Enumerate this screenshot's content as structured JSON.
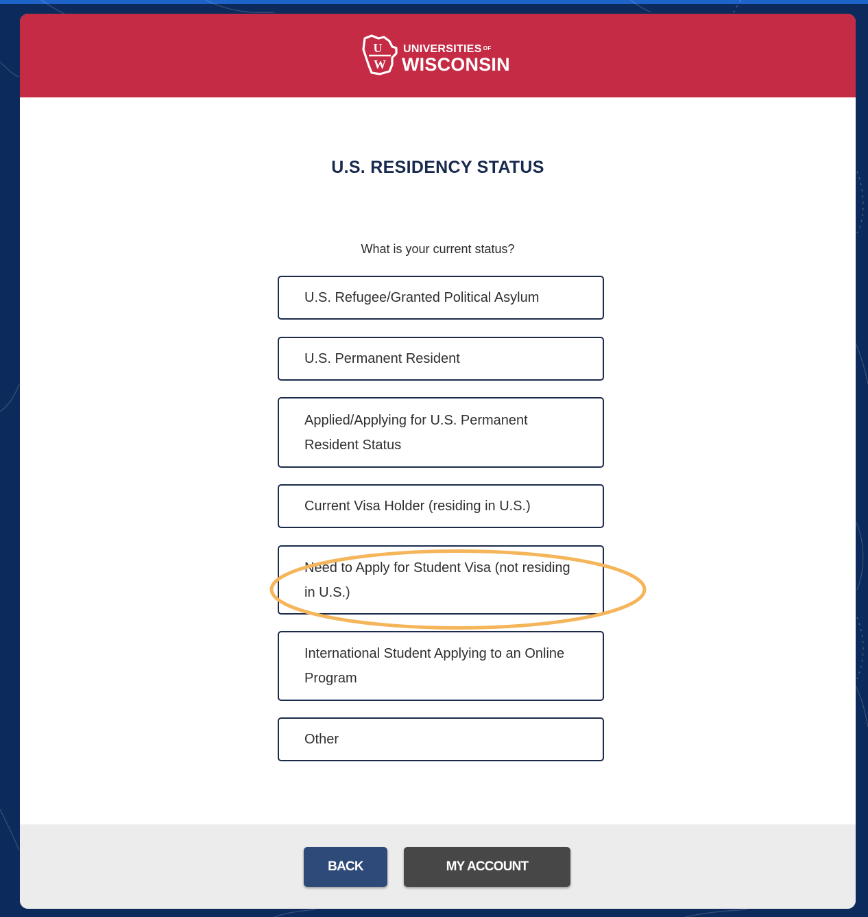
{
  "brand": {
    "line1": "UNIVERSITIES",
    "line1_of": "OF",
    "line2": "WISCONSIN",
    "mark_top": "U",
    "mark_bottom": "W"
  },
  "page": {
    "title": "U.S. RESIDENCY STATUS",
    "question": "What is your current status?"
  },
  "options": [
    "U.S. Refugee/Granted Political Asylum",
    "U.S. Permanent Resident",
    "Applied/Applying for U.S. Permanent Resident Status",
    "Current Visa Holder (residing in U.S.)",
    "Need to Apply for Student Visa (not residing in U.S.)",
    "International Student Applying to an Online Program",
    "Other"
  ],
  "footer": {
    "back_label": "BACK",
    "account_label": "MY ACCOUNT"
  },
  "colors": {
    "header": "#c52b45",
    "page_background": "#0c2b5c",
    "title": "#17294d",
    "back_button": "#2d4a78",
    "account_button": "#474747",
    "highlight_ring": "#f5b55a"
  }
}
